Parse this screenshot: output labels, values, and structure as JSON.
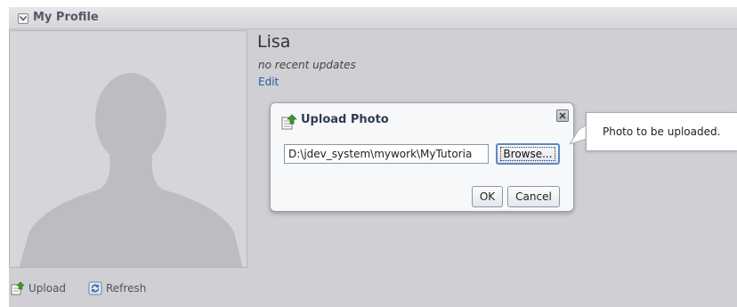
{
  "panel": {
    "title": "My Profile",
    "colors": {
      "panel_bg": "#cfcfd4",
      "link": "#2a5aa8"
    }
  },
  "profile": {
    "name": "Lisa",
    "updates_text": "no recent updates",
    "edit_label": "Edit",
    "photo_icon": "person-silhouette"
  },
  "dialog": {
    "title": "Upload Photo",
    "title_icon": "upload-photo-icon",
    "close_icon": "close-icon",
    "file_value": "D:\\jdev_system\\mywork\\MyTutoria",
    "browse_label": "Browse...",
    "ok_label": "OK",
    "cancel_label": "Cancel"
  },
  "tooltip": {
    "text": "Photo to be uploaded."
  },
  "footer": {
    "upload_label": "Upload",
    "upload_icon": "upload-icon",
    "refresh_label": "Refresh",
    "refresh_icon": "refresh-icon"
  }
}
